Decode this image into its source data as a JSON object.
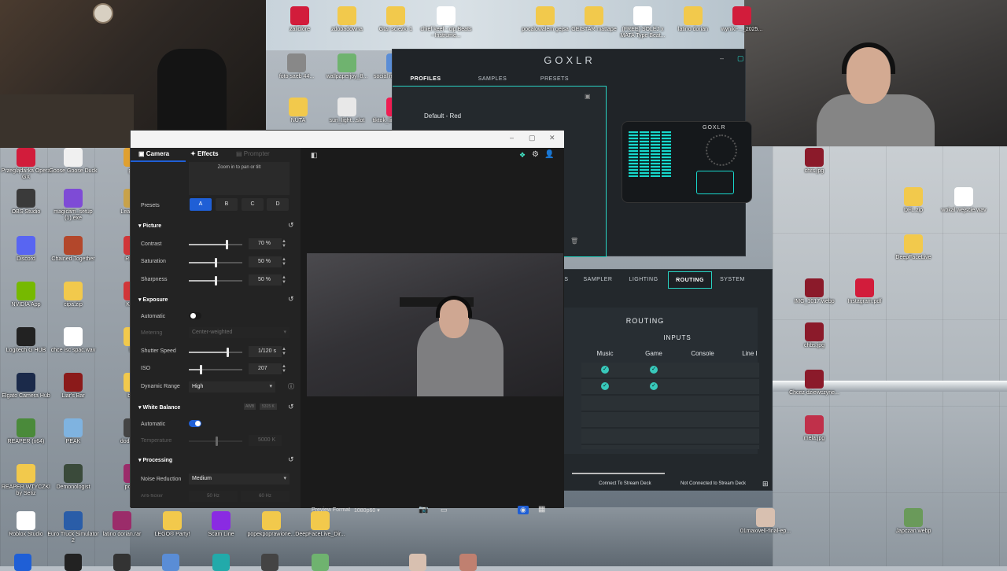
{
  "camera_hub": {
    "tabs": [
      "Camera",
      "Effects",
      "Prompter"
    ],
    "zoom_hint": "Zoom in to pan or tilt",
    "presets_label": "Presets",
    "presets": [
      "A",
      "B",
      "C",
      "D"
    ],
    "active_preset": "A",
    "picture": {
      "title": "Picture",
      "contrast_label": "Contrast",
      "contrast_value": "70 %",
      "contrast_level": 0.7,
      "saturation_label": "Saturation",
      "saturation_value": "50 %",
      "saturation_level": 0.5,
      "sharpness_label": "Sharpness",
      "sharpness_value": "50 %",
      "sharpness_level": 0.5
    },
    "exposure": {
      "title": "Exposure",
      "automatic_label": "Automatic",
      "metering_label": "Metering",
      "metering_value": "Center-weighted",
      "shutter_label": "Shutter Speed",
      "shutter_value": "1/120 s",
      "shutter_level": 0.72,
      "iso_label": "ISO",
      "iso_value": "207",
      "iso_level": 0.22,
      "dynamic_range_label": "Dynamic Range",
      "dynamic_range_value": "High"
    },
    "white_balance": {
      "title": "White Balance",
      "badge_awb": "AWB",
      "badge_temp": "5315 K",
      "automatic_label": "Automatic",
      "automatic_on": true,
      "temperature_label": "Temperature",
      "temperature_value": "5000 K"
    },
    "processing": {
      "title": "Processing",
      "noise_label": "Noise Reduction",
      "noise_value": "Medium",
      "antiflicker_label": "Anti-flicker",
      "flicker_50": "50 Hz",
      "flicker_60": "60 Hz"
    },
    "preview_format_label": "Preview Format",
    "preview_format_value": "1080p60"
  },
  "goxlr": {
    "logo": "GOXLR",
    "top_tabs": [
      "PROFILES",
      "SAMPLES",
      "PRESETS"
    ],
    "active_top_tab": "PROFILES",
    "profile": "Default - Red",
    "mixer_logo": "GOXLR",
    "bottom_tabs": [
      "S",
      "SAMPLER",
      "LIGHTING",
      "ROUTING",
      "SYSTEM"
    ],
    "active_bottom_tab": "ROUTING",
    "routing_title": "ROUTING",
    "inputs_label": "INPUTS",
    "input_columns": [
      "Music",
      "Game",
      "Console",
      "Line I"
    ],
    "status_left": "Connect To Stream Deck",
    "status_right": "Not Connected to Stream Deck"
  },
  "desktop_icons_left": [
    {
      "label": "Przeglądarka Opera GX",
      "color": "#d21c3b"
    },
    {
      "label": "Goose Goose Duck",
      "color": "#f0f0f0"
    },
    {
      "label": "OBS Studio",
      "color": "#3a3a3a"
    },
    {
      "label": "magicam_setup (1).exe",
      "color": "#7e4bd6"
    },
    {
      "label": "Discord",
      "color": "#5865f2"
    },
    {
      "label": "Chained Together",
      "color": "#b3472b"
    },
    {
      "label": "NVIDIA App",
      "color": "#76b900"
    },
    {
      "label": "cipa.zip",
      "color": "#f2c94c"
    },
    {
      "label": "Logitech G HUB",
      "color": "#222222"
    },
    {
      "label": "chce isc spac.wav",
      "color": "#ffffff"
    },
    {
      "label": "Elgato Camera Hub",
      "color": "#1b2a4a"
    },
    {
      "label": "Liar's Bar",
      "color": "#8b1a1a"
    },
    {
      "label": "REAPER (x64)",
      "color": "#4a8a3a"
    },
    {
      "label": "PEAK",
      "color": "#7fb3e0"
    },
    {
      "label": "REAPER WTYCZKI by Setiz",
      "color": "#f2c94c"
    },
    {
      "label": "Demonologist",
      "color": "#3a4a3a"
    },
    {
      "label": "Roblox Studio",
      "color": "#ffffff"
    },
    {
      "label": "Euro Truck Simulator 2",
      "color": "#2a5da8"
    },
    {
      "label": "latino dorian.rar",
      "color": "#9b2c6a"
    },
    {
      "label": "LEGO® Party!",
      "color": "#f2c94c"
    },
    {
      "label": "Scam Line",
      "color": "#8a2be2"
    },
    {
      "label": "popekpoprawione...",
      "color": "#f2c94c"
    },
    {
      "label": "DeepFaceLive_Dir...",
      "color": "#f2c94c"
    }
  ],
  "desktop_icons_partial": [
    {
      "label": "pex",
      "color": "#e0a030"
    },
    {
      "label": "League of",
      "color": "#c8a24a"
    },
    {
      "label": "Riot C",
      "color": "#d13639"
    },
    {
      "label": "Klient",
      "color": "#d13639"
    },
    {
      "label": "bal",
      "color": "#f2c94c"
    },
    {
      "label": "brak",
      "color": "#f2c94c"
    },
    {
      "label": "dodat glos",
      "color": "#444444"
    },
    {
      "label": "pocalo",
      "color": "#9b2c6a"
    }
  ],
  "desktop_icons_top": [
    {
      "label": "zalidlore",
      "color": "#d21c3b"
    },
    {
      "label": "zdobadowna",
      "color": "#f2c94c"
    },
    {
      "label": "Gtar sciezki 1",
      "color": "#f2c94c"
    },
    {
      "label": "chief keef - cip Beats - Instrume...",
      "color": "#ffffff"
    },
    {
      "label": "pocalowalem gejsa",
      "color": "#f2c94c"
    },
    {
      "label": "GEISTAR mattape",
      "color": "#f2c94c"
    },
    {
      "label": "(FREE) SOLEJ x MATA Type Beat...",
      "color": "#ffffff"
    },
    {
      "label": "latino dorian",
      "color": "#f2c94c"
    },
    {
      "label": "wyniki-..._2025...",
      "color": "#d21c3b"
    },
    {
      "label": "foto saeb 44...",
      "color": "#888888"
    },
    {
      "label": "wallpaperjoy_8...",
      "color": "#6fb36f"
    },
    {
      "label": "social media dla...",
      "color": "#5a8dd6"
    },
    {
      "label": "NUTA",
      "color": "#f2c94c"
    },
    {
      "label": "sun_light...slot",
      "color": "#e8e8e8"
    },
    {
      "label": "tiktok_line_prodn...",
      "color": "#ee1d52"
    }
  ],
  "desktop_icons_right": [
    {
      "label": "chrs.jpg",
      "color": "#8b1a2a"
    },
    {
      "label": "DFL.zip",
      "color": "#f2c94c"
    },
    {
      "label": "wokal wejscie.wav",
      "color": "#ffffff"
    },
    {
      "label": "DeepFaceLive",
      "color": "#f2c94c"
    },
    {
      "label": "IMG_1017.webp",
      "color": "#8b1a2a"
    },
    {
      "label": "Instagram.pdf",
      "color": "#d21c3b"
    },
    {
      "label": "chbs.jpg",
      "color": "#8b1a2a"
    },
    {
      "label": "Chcez dziewczyne...",
      "color": "#8b1a2a"
    },
    {
      "label": "mela.jpg",
      "color": "#c0304a"
    },
    {
      "label": "01maxwell-final-ep...",
      "color": "#d8c0b0"
    },
    {
      "label": "Japczan.webp",
      "color": "#6a9a5a"
    }
  ]
}
